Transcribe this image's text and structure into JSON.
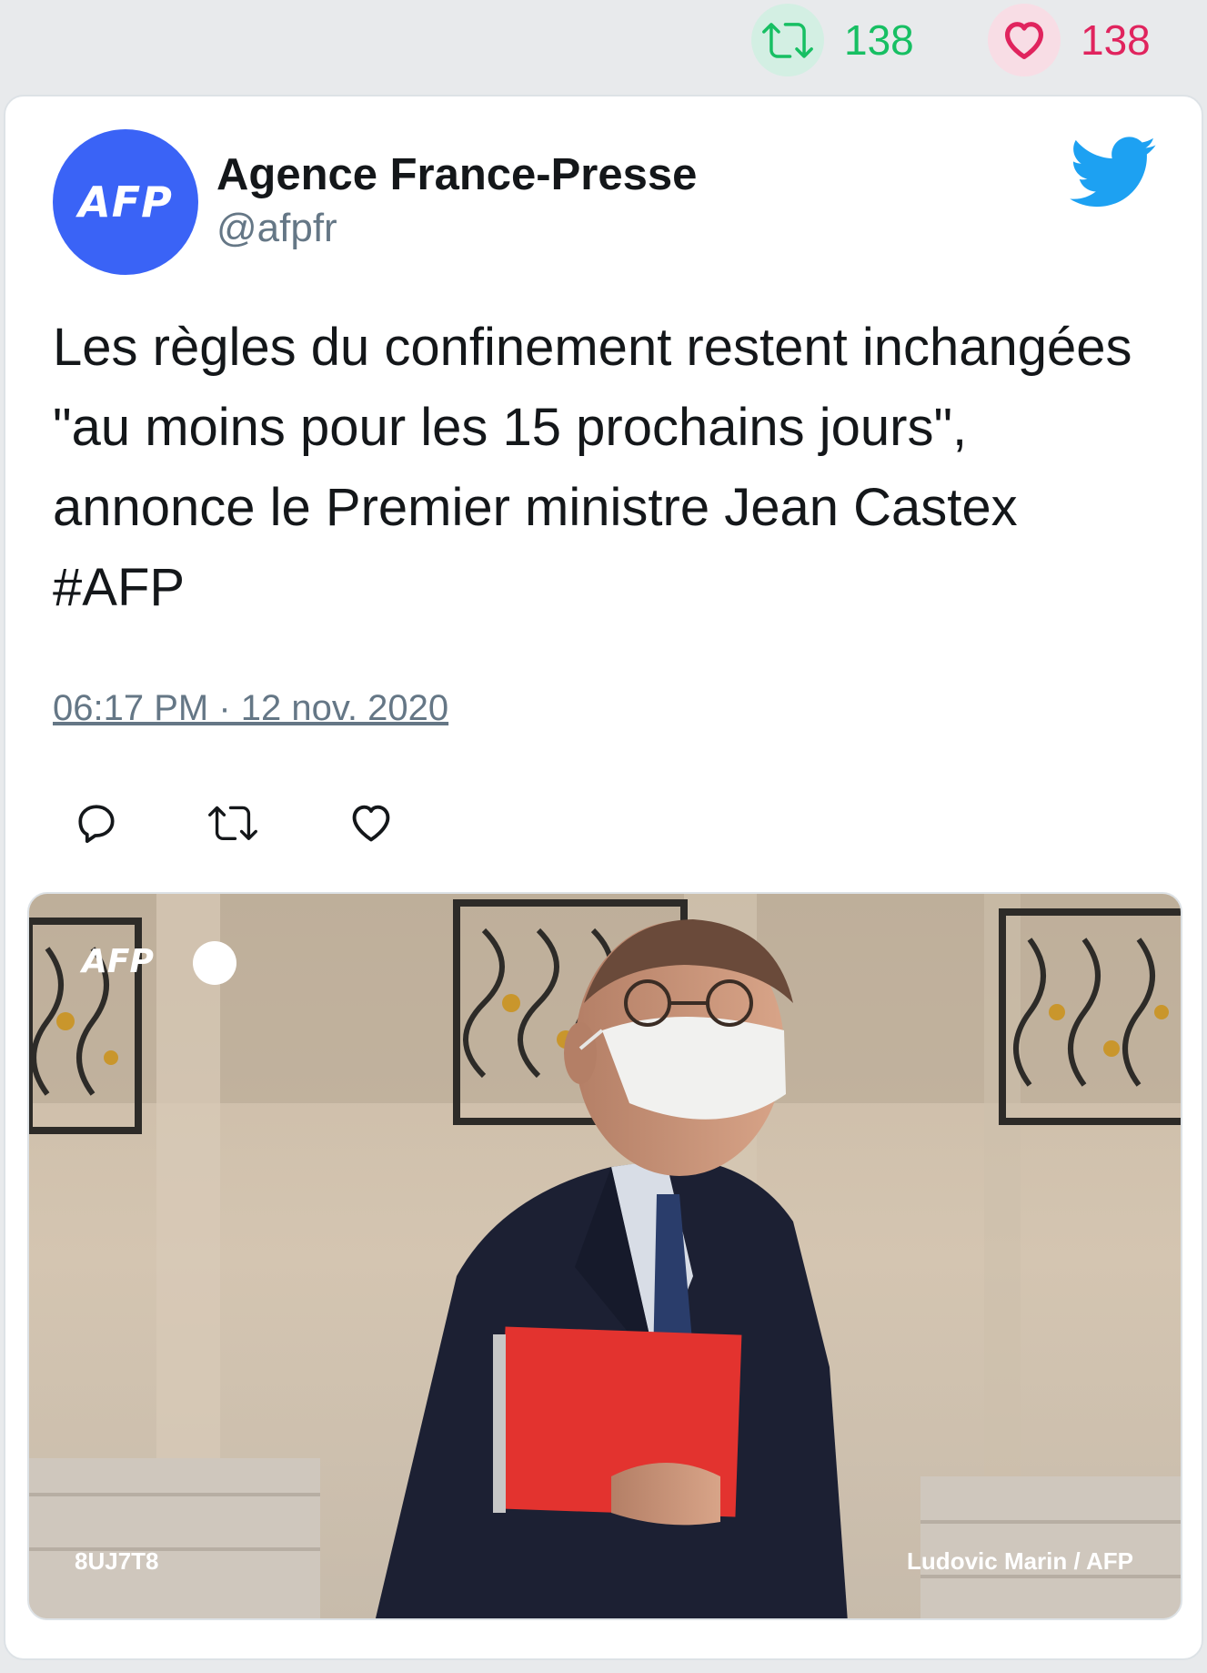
{
  "stats": {
    "retweet_count": "138",
    "like_count": "138"
  },
  "tweet": {
    "avatar_text": "AFP",
    "display_name": "Agence France-Presse",
    "handle": "@afpfr",
    "text": "Les règles du confinement restent inchangées \"au moins pour les 15 prochains jours\", annonce le Premier ministre Jean Castex #AFP",
    "timestamp": "06:17 PM · 12 nov. 2020"
  },
  "media": {
    "logo_text": "AFP",
    "photo_id": "8UJ7T8",
    "credit": "Ludovic Marin / AFP"
  },
  "icons": {
    "retweet": "retweet-icon",
    "like": "heart-icon",
    "reply": "reply-icon",
    "brand": "twitter-bird-icon"
  },
  "colors": {
    "retweet_green": "#17bf63",
    "like_red": "#e0245e",
    "twitter_blue": "#1da1f2",
    "avatar_blue": "#3a63f6",
    "muted_text": "#657786"
  }
}
